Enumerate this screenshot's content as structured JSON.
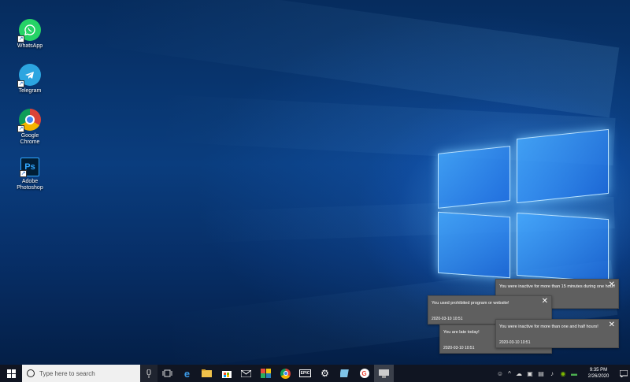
{
  "desktop_icons": [
    {
      "label": "WhatsApp",
      "icon": "whatsapp-icon",
      "color": "#25d366"
    },
    {
      "label": "Telegram",
      "icon": "telegram-icon",
      "color": "#2ca5e0"
    },
    {
      "label": "Google Chrome",
      "icon": "chrome-icon",
      "color": "#4285f4"
    },
    {
      "label": "Adobe Photoshop",
      "icon": "photoshop-icon",
      "color": "#001e36"
    }
  ],
  "notifications": [
    {
      "message": "You were inactive for more than 15 minutes during one hour!",
      "time": ""
    },
    {
      "message": "You used prohibited program or website!",
      "time": "2020-03-10 10:51"
    },
    {
      "message": "You were inactive for more than one and half hours!",
      "time": "2020-03-10 10:51"
    },
    {
      "message": "You are late today!",
      "time": "2020-03-10 10:51"
    }
  ],
  "taskbar": {
    "search_placeholder": "Type here to search",
    "epic_label": "EPIC",
    "clock_time": "9:35 PM",
    "clock_date": "2/26/2020"
  }
}
